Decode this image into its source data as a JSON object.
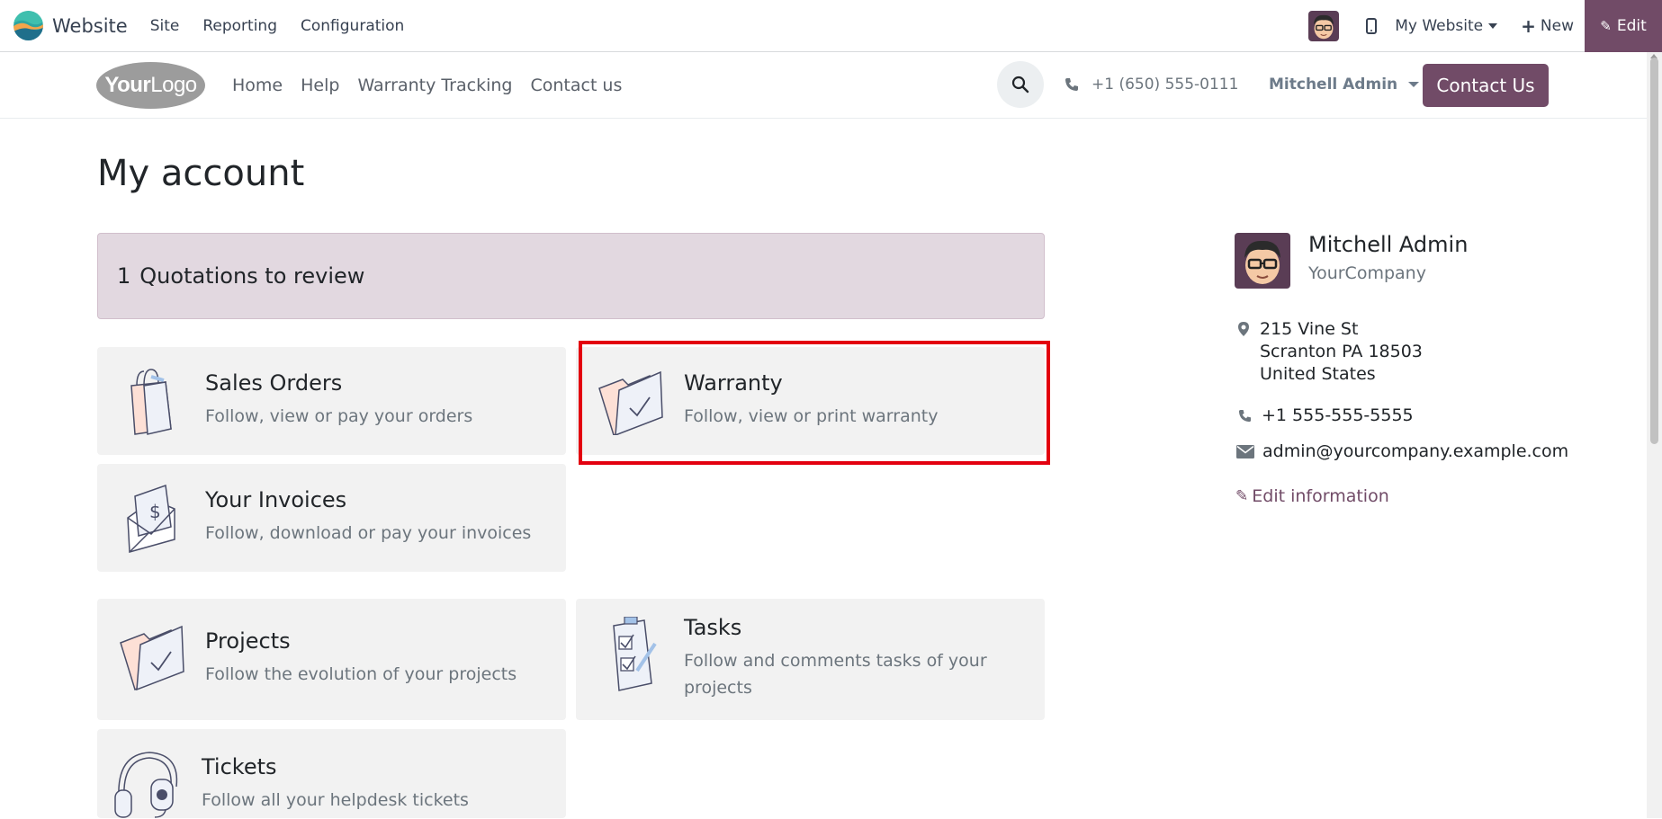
{
  "topbar": {
    "app_name": "Website",
    "menu": [
      "Site",
      "Reporting",
      "Configuration"
    ],
    "website_selector": "My Website",
    "new_label": "New",
    "edit_label": "Edit"
  },
  "header": {
    "logo_bold": "Your",
    "logo_light": "Logo",
    "nav": [
      "Home",
      "Help",
      "Warranty Tracking",
      "Contact us"
    ],
    "phone": "+1 (650) 555-0111",
    "user": "Mitchell Admin",
    "contact_button": "Contact Us"
  },
  "main": {
    "title": "My account",
    "quotations": {
      "count": "1",
      "label": "Quotations to review"
    },
    "cards": [
      {
        "title": "Sales Orders",
        "desc": "Follow, view or pay your orders",
        "icon": "shopping-bag-icon"
      },
      {
        "title": "Warranty",
        "desc": "Follow, view or print warranty",
        "icon": "folder-check-icon"
      },
      {
        "title": "Your Invoices",
        "desc": "Follow, download or pay your invoices",
        "icon": "invoice-envelope-icon"
      },
      {
        "title": "Projects",
        "desc": "Follow the evolution of your projects",
        "icon": "folder-check-icon"
      },
      {
        "title": "Tasks",
        "desc": "Follow and comments tasks of your projects",
        "icon": "checklist-icon"
      },
      {
        "title": "Tickets",
        "desc": "Follow all your helpdesk tickets",
        "icon": "headset-icon"
      }
    ]
  },
  "sidebar": {
    "name": "Mitchell Admin",
    "company": "YourCompany",
    "address": [
      "215 Vine St",
      "Scranton PA 18503",
      "United States"
    ],
    "phone": "+1 555-555-5555",
    "email": "admin@yourcompany.example.com",
    "edit_label": "Edit information"
  },
  "colors": {
    "brand": "#714B67",
    "highlight": "#e3000f",
    "banner": "#e2d8e0"
  }
}
